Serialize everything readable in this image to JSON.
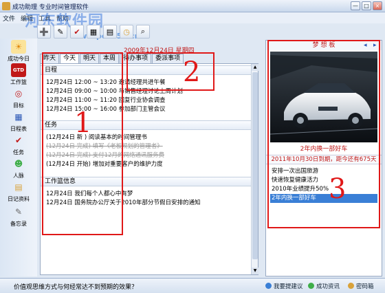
{
  "window": {
    "title": "成功助理 专业时间管理软件",
    "buttons": [
      "—",
      "□",
      "×"
    ]
  },
  "watermark": {
    "main": "河东软件园",
    "url": "www.pc0359.cn"
  },
  "menu": [
    "文件",
    "编辑",
    "工具",
    "帮助"
  ],
  "toolbar_icons": [
    "new-task-icon",
    "edit-icon",
    "check-icon",
    "calendar-icon",
    "note-icon",
    "clock-icon",
    "search-icon"
  ],
  "nav": [
    {
      "label": "成功今日",
      "icon": "sun-icon",
      "glyph": "☀"
    },
    {
      "label": "工作篮",
      "icon": "basket-icon",
      "glyph": "GTD"
    },
    {
      "label": "目标",
      "icon": "target-icon",
      "glyph": "◎"
    },
    {
      "label": "日程表",
      "icon": "schedule-icon",
      "glyph": "▦"
    },
    {
      "label": "任务",
      "icon": "task-icon",
      "glyph": "✔"
    },
    {
      "label": "人脉",
      "icon": "people-icon",
      "glyph": "☻"
    },
    {
      "label": "日记资料",
      "icon": "diary-icon",
      "glyph": "▤"
    },
    {
      "label": "备忘录",
      "icon": "memo-icon",
      "glyph": "✎"
    }
  ],
  "date_header": "2009年12月24日 星期四",
  "tabs": [
    "昨天",
    "今天",
    "明天",
    "本周",
    "待办事项",
    "委派事项"
  ],
  "active_tab": "今天",
  "sections": {
    "schedule": {
      "title": "日程",
      "rows": [
        "12月24日 12:00 ~ 13:20 邀请经理共进午餐",
        "12月24日 09:00 ~ 10:00 与销售经理讨论上周计划",
        "12月24日 11:00 ~ 11:20 回复行业协会调查",
        "12月24日 15:00 ~ 16:00 参加部门主管会议"
      ]
    },
    "tasks": {
      "title": "任务",
      "rows": [
        {
          "text": "(12月24日 新 ) 阅读基本的时间管理书",
          "done": false
        },
        {
          "text": "(12月24日 完成) 填写《老板规划的管理者》",
          "done": true
        },
        {
          "text": "(12月24日 完成) 支付12月的网络通讯服务费",
          "done": true
        },
        {
          "text": "(12月24日 开始) 增加对重要客户的维护力度",
          "done": false
        }
      ]
    },
    "notes": {
      "title": "工作篮信息",
      "rows": [
        "12月24日 我们每个人都心中有梦",
        "12月24日 国务院办公厅关于2010年部分节假日安排的通知"
      ]
    }
  },
  "dream": {
    "title": "梦 想 板",
    "prev": "◂",
    "next": "▸",
    "caption": "2年内换一部好车",
    "countdown": "2011年10月30日到期，距今还有675天",
    "goals": [
      {
        "text": "安排一次出国旅游",
        "selected": false
      },
      {
        "text": "快速恢复健康活力",
        "selected": false
      },
      {
        "text": "2010年业绩提升50%",
        "selected": false
      },
      {
        "text": "2年内换一部好车",
        "selected": true
      }
    ]
  },
  "status": {
    "text": "价值观思维方式与何经常达不到预期的效果？",
    "links": [
      {
        "label": "我要提建议",
        "color": "#3a7fd6"
      },
      {
        "label": "成功资讯",
        "color": "#3fae49"
      },
      {
        "label": "密码箱",
        "color": "#d9a23a"
      }
    ]
  },
  "annotations": [
    "1",
    "2",
    "3"
  ]
}
